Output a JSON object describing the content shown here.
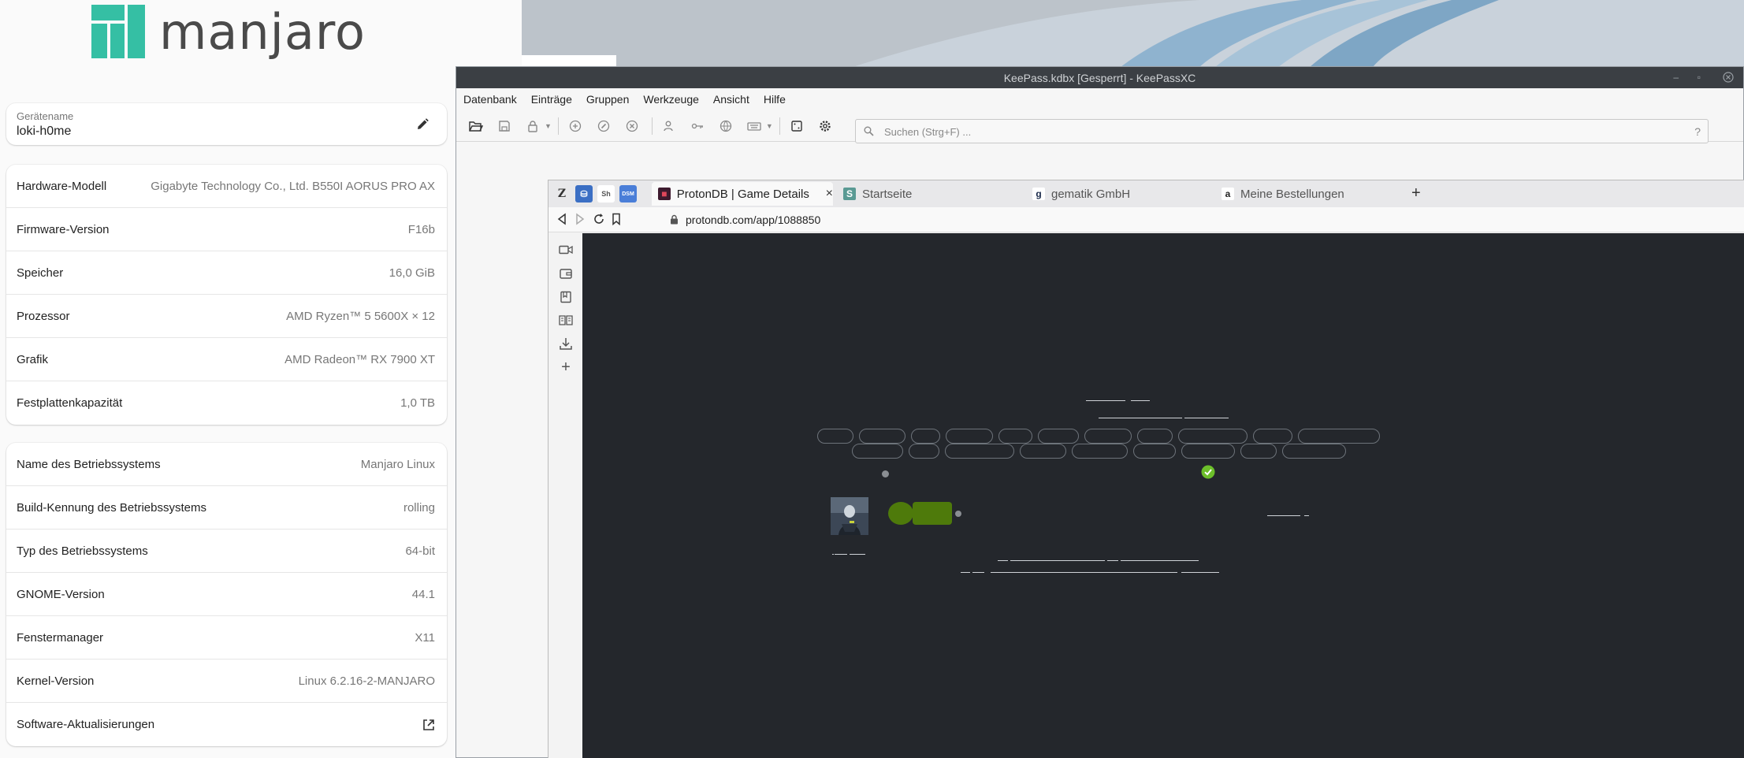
{
  "about": {
    "logo_text": "manjaro",
    "logo_color": "#35bfa4",
    "device": {
      "label": "Gerätename",
      "value": "loki-h0me"
    },
    "hardware": [
      {
        "key": "Hardware-Modell",
        "value": "Gigabyte Technology Co., Ltd. B550I AORUS PRO AX"
      },
      {
        "key": "Firmware-Version",
        "value": "F16b"
      },
      {
        "key": "Speicher",
        "value": "16,0 GiB"
      },
      {
        "key": "Prozessor",
        "value": "AMD Ryzen™ 5 5600X × 12"
      },
      {
        "key": "Grafik",
        "value": "AMD Radeon™ RX 7900 XT"
      },
      {
        "key": "Festplattenkapazität",
        "value": "1,0 TB"
      }
    ],
    "os": [
      {
        "key": "Name des Betriebssystems",
        "value": "Manjaro Linux"
      },
      {
        "key": "Build-Kennung des Betriebssystems",
        "value": "rolling"
      },
      {
        "key": "Typ des Betriebssystems",
        "value": "64-bit"
      },
      {
        "key": "GNOME-Version",
        "value": "44.1"
      },
      {
        "key": "Fenstermanager",
        "value": "X11"
      },
      {
        "key": "Kernel-Version",
        "value": "Linux 6.2.16-2-MANJARO"
      }
    ],
    "software_updates": "Software-Aktualisierungen"
  },
  "keepass": {
    "title": "KeePass.kdbx [Gesperrt] - KeePassXC",
    "menu": [
      "Datenbank",
      "Einträge",
      "Gruppen",
      "Werkzeuge",
      "Ansicht",
      "Hilfe"
    ],
    "search_placeholder": "Suchen (Strg+F) ...",
    "help_glyph": "?"
  },
  "browser": {
    "pinned": [
      {
        "glyph": "Z",
        "icon": "zotero-icon"
      },
      {
        "glyph": "⛁",
        "icon": "calendar-app-icon"
      },
      {
        "glyph": "Sh",
        "icon": "shop-icon"
      },
      {
        "glyph": "DSM",
        "icon": "dsm-icon"
      }
    ],
    "tabs": [
      {
        "label": "ProtonDB | Game Details",
        "favicon": "protondb-icon",
        "active": true
      },
      {
        "label": "Startseite",
        "favicon": "startseite-icon",
        "active": false
      },
      {
        "label": "gematik GmbH",
        "favicon": "gematik-icon",
        "active": false
      },
      {
        "label": "Meine Bestellungen",
        "favicon": "amazon-icon",
        "active": false
      }
    ],
    "new_tab": "+",
    "url": "protondb.com/app/1088850",
    "content_bg": "#24272c",
    "rating_color": "#4e7a0b",
    "check_color": "#6cbf2a"
  }
}
